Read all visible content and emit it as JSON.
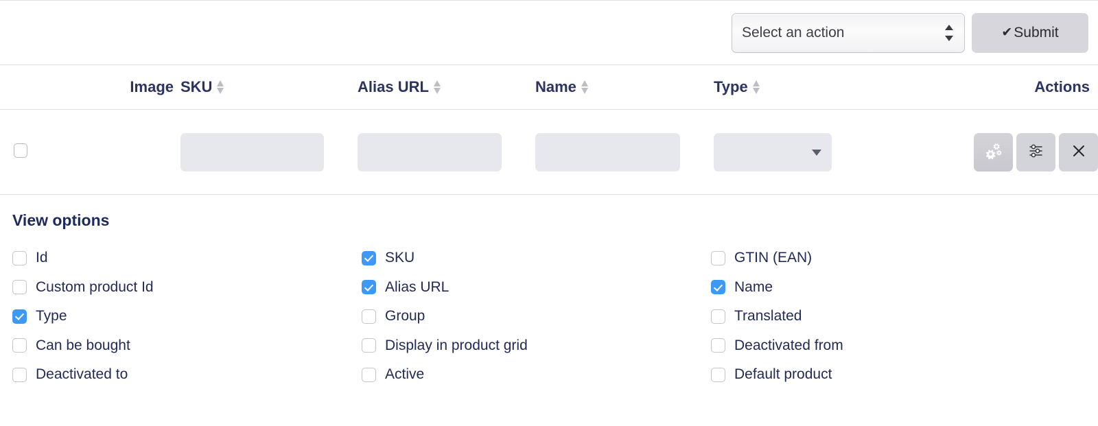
{
  "toolbar": {
    "action_select_value": "Select an action",
    "submit_label": "Submit",
    "submit_icon": "check-icon",
    "stepper_icon": "stepper-updown-icon"
  },
  "table": {
    "columns": [
      {
        "key": "image",
        "label": "Image",
        "sortable": false,
        "align": "right"
      },
      {
        "key": "sku",
        "label": "SKU",
        "sortable": true,
        "align": "left"
      },
      {
        "key": "alias",
        "label": "Alias URL",
        "sortable": true,
        "align": "left"
      },
      {
        "key": "name",
        "label": "Name",
        "sortable": true,
        "align": "left"
      },
      {
        "key": "type",
        "label": "Type",
        "sortable": true,
        "align": "left"
      },
      {
        "key": "actions",
        "label": "Actions",
        "sortable": false,
        "align": "right"
      }
    ],
    "sort_icon": "sort-updown-icon",
    "filter_row": {
      "select_all_checked": false,
      "sku_value": "",
      "sku_placeholder": "",
      "alias_value": "",
      "alias_placeholder": "",
      "name_value": "",
      "name_placeholder": "",
      "type_value": "",
      "type_caret_icon": "caret-down-icon",
      "actions": [
        {
          "name": "settings-gears-button",
          "icon": "gears-icon",
          "state": "active"
        },
        {
          "name": "filters-sliders-button",
          "icon": "sliders-icon",
          "state": "normal"
        },
        {
          "name": "clear-button",
          "icon": "close-x-icon",
          "state": "normal"
        }
      ]
    }
  },
  "view_options": {
    "title": "View options",
    "columns": [
      [
        {
          "label": "Id",
          "checked": false
        },
        {
          "label": "Custom product Id",
          "checked": false
        },
        {
          "label": "Type",
          "checked": true
        },
        {
          "label": "Can be bought",
          "checked": false
        },
        {
          "label": "Deactivated to",
          "checked": false
        }
      ],
      [
        {
          "label": "SKU",
          "checked": true
        },
        {
          "label": "Alias URL",
          "checked": true
        },
        {
          "label": "Group",
          "checked": false
        },
        {
          "label": "Display in product grid",
          "checked": false
        },
        {
          "label": "Active",
          "checked": false
        }
      ],
      [
        {
          "label": "GTIN (EAN)",
          "checked": false
        },
        {
          "label": "Name",
          "checked": true
        },
        {
          "label": "Translated",
          "checked": false
        },
        {
          "label": "Deactivated from",
          "checked": false
        },
        {
          "label": "Default product",
          "checked": false
        }
      ]
    ]
  },
  "colors": {
    "accent_checked": "#3d99f5",
    "heading_text": "#1d2a5e",
    "border": "#dfdfe5",
    "input_fill": "#e7e7ee",
    "button_fill": "#d3d3da"
  }
}
